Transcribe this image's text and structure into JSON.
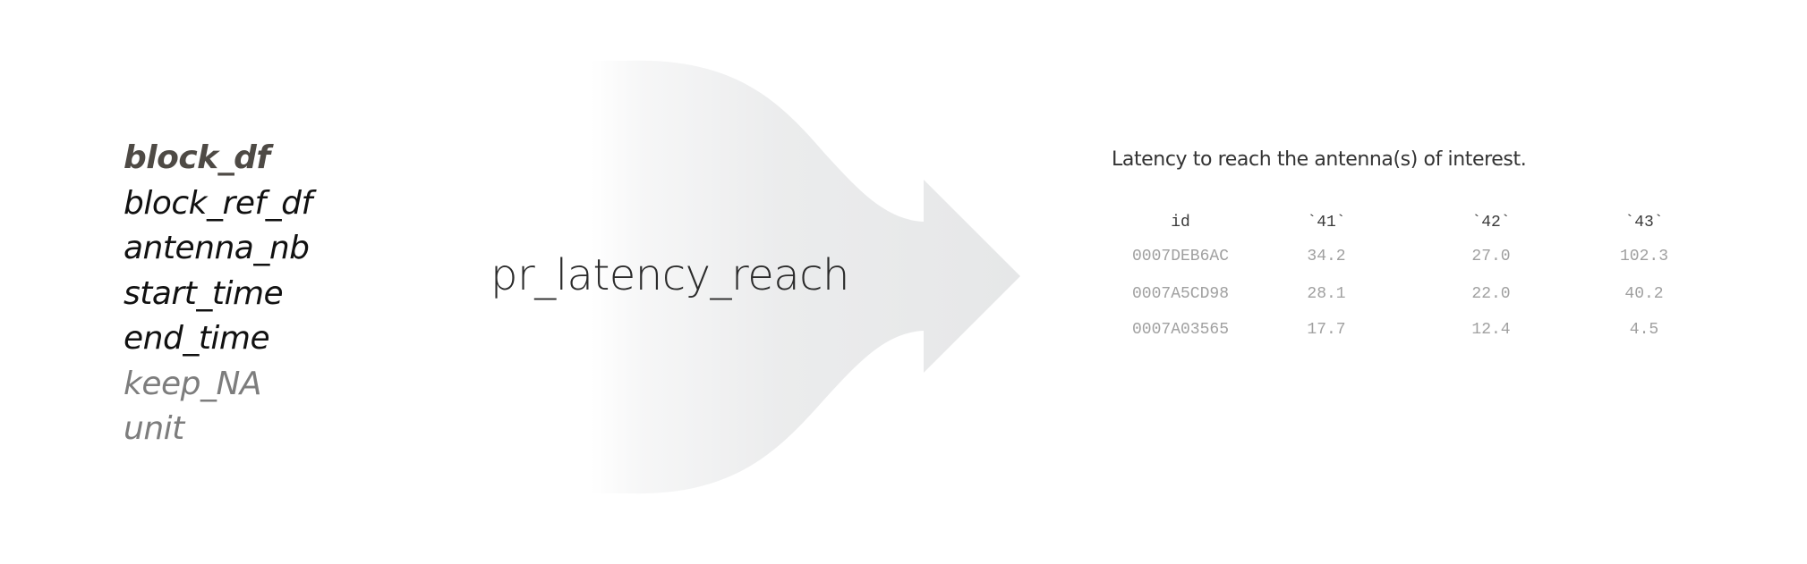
{
  "arguments": [
    {
      "name": "block_df",
      "kind": "primary"
    },
    {
      "name": "block_ref_df",
      "kind": "required"
    },
    {
      "name": "antenna_nb",
      "kind": "required"
    },
    {
      "name": "start_time",
      "kind": "required"
    },
    {
      "name": "end_time",
      "kind": "required"
    },
    {
      "name": "keep_NA",
      "kind": "optional"
    },
    {
      "name": "unit",
      "kind": "optional"
    }
  ],
  "function_name": "pr_latency_reach",
  "output": {
    "description": "Latency to reach the antenna(s) of interest.",
    "columns": [
      "id",
      "`41`",
      "`42`",
      "`43`"
    ],
    "rows": [
      [
        "0007DEB6AC",
        "34.2",
        "27.0",
        "102.3"
      ],
      [
        "0007A5CD98",
        "28.1",
        "22.0",
        "40.2"
      ],
      [
        "0007A03565",
        "17.7",
        "12.4",
        "4.5"
      ]
    ]
  },
  "colors": {
    "primary_arg": "#4e4a45",
    "required_arg": "#111111",
    "optional_arg": "#7d7d7d",
    "arrow": "#e6e7e8",
    "table_header": "#3a3a3a",
    "table_values": "#a0a0a0"
  }
}
